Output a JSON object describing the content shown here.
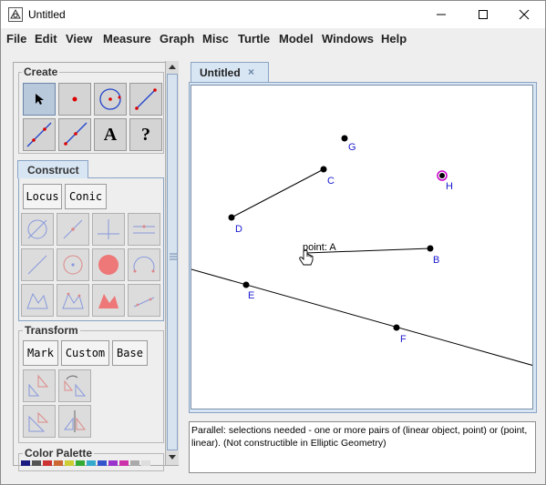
{
  "window": {
    "title": "Untitled",
    "minimize_icon": "minimize-icon",
    "maximize_icon": "maximize-icon",
    "close_icon": "close-icon"
  },
  "menubar": {
    "items": [
      "File",
      "Edit",
      "View",
      "Measure",
      "Graph",
      "Misc",
      "Turtle",
      "Model",
      "Windows",
      "Help"
    ]
  },
  "toolbox": {
    "create": {
      "label": "Create",
      "tools": [
        "arrow-select-icon",
        "point-tool-icon",
        "circle-tool-icon",
        "segment-tool-icon",
        "line-tool-icon",
        "ray-tool-icon",
        "text-tool-icon",
        "help-tool-icon"
      ],
      "text_tool_glyph": "A",
      "help_tool_glyph": "?"
    },
    "construct": {
      "tab_label": "Construct",
      "buttons": [
        "Locus",
        "Conic"
      ],
      "tools": [
        "intersection-icon",
        "midpoint-icon",
        "perpendicular-icon",
        "parallel-icon",
        "segment-between-icon",
        "circle-center-icon",
        "circle-interior-icon",
        "arc-icon",
        "polygon-icon",
        "polygon-interior-icon",
        "polygon-filled-icon",
        "angle-bisector-icon"
      ]
    },
    "transform": {
      "label": "Transform",
      "buttons": [
        "Mark",
        "Custom",
        "Base"
      ],
      "tools": [
        "translate-icon",
        "rotate-icon",
        "dilate-icon",
        "reflect-icon"
      ]
    },
    "color_palette": {
      "label": "Color Palette"
    }
  },
  "document": {
    "tab_label": "Untitled",
    "tab_close_glyph": "×"
  },
  "canvas": {
    "points": [
      "A",
      "B",
      "C",
      "D",
      "E",
      "F",
      "G",
      "H"
    ],
    "hover_label": "point: A",
    "accent_point_color": "#cc00cc",
    "label_color": "#1a1ad0"
  },
  "status": {
    "message": "Parallel: selections needed - one or more pairs of (linear object, point) or (point, linear). (Not constructible in Elliptic Geometry)"
  }
}
